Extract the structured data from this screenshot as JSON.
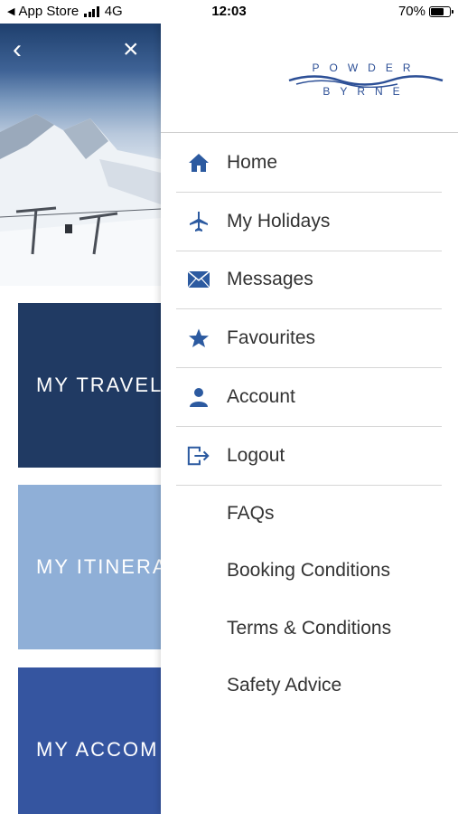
{
  "status_bar": {
    "carrier": "App Store",
    "network": "4G",
    "time": "12:03",
    "battery": "70%",
    "battery_level": 0.7
  },
  "background_app": {
    "tiles": [
      {
        "label": "MY TRAVEL"
      },
      {
        "label": "MY ITINERA"
      },
      {
        "label": "MY ACCOM"
      }
    ]
  },
  "drawer": {
    "logo": {
      "top": "POWDER",
      "bottom": "BYRNE"
    },
    "menu": [
      {
        "label": "Home",
        "icon": "home-icon"
      },
      {
        "label": "My Holidays",
        "icon": "airplane-icon"
      },
      {
        "label": "Messages",
        "icon": "envelope-icon"
      },
      {
        "label": "Favourites",
        "icon": "star-icon"
      },
      {
        "label": "Account",
        "icon": "person-icon"
      },
      {
        "label": "Logout",
        "icon": "logout-icon"
      }
    ],
    "links": [
      {
        "label": "FAQs"
      },
      {
        "label": "Booking Conditions"
      },
      {
        "label": "Terms & Conditions"
      },
      {
        "label": "Safety Advice"
      }
    ]
  },
  "colors": {
    "accent": "#2c5aa0",
    "navy_tile": "#203a63",
    "light_tile": "#8fafd7",
    "mid_tile": "#3555a0",
    "text": "#333333"
  }
}
